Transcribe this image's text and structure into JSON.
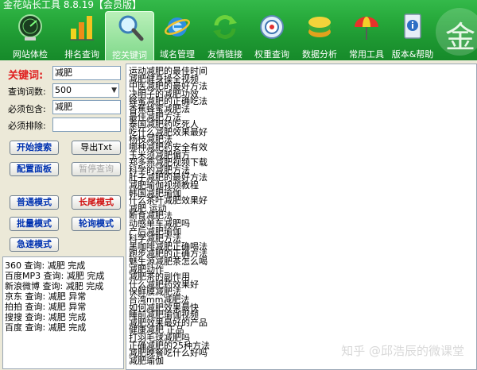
{
  "title": "金花站长工具 8.8.19【会员版】",
  "brand_char": "金",
  "toolbar": [
    {
      "label": "网站体检",
      "icon": "chart-globe-icon"
    },
    {
      "label": "排名查询",
      "icon": "bar-chart-icon"
    },
    {
      "label": "挖关键词",
      "icon": "magnifier-icon"
    },
    {
      "label": "域名管理",
      "icon": "ie-icon"
    },
    {
      "label": "友情链接",
      "icon": "refresh-icon"
    },
    {
      "label": "权重查询",
      "icon": "target-icon"
    },
    {
      "label": "数据分析",
      "icon": "data-stack-icon"
    },
    {
      "label": "常用工具",
      "icon": "umbrella-icon"
    },
    {
      "label": "版本&帮助",
      "icon": "info-icon"
    }
  ],
  "form": {
    "keyword_label": "关键词:",
    "keyword_value": "减肥",
    "query_count_label": "查询词数:",
    "query_count_value": "500",
    "must_include_label": "必须包含:",
    "must_include_value": "减肥",
    "must_exclude_label": "必须排除:",
    "must_exclude_value": ""
  },
  "buttons": {
    "start_search": "开始搜索",
    "export_txt": "导出Txt",
    "config_panel": "配置面板",
    "pause_query": "暂停查询",
    "normal_mode": "普通模式",
    "longtail_mode": "长尾模式",
    "batch_mode": "批量模式",
    "rotation_mode": "轮询模式",
    "fast_mode": "急速模式"
  },
  "log": [
    "360 查询: 减肥 完成",
    "百度MP3 查询: 减肥 完成",
    "新浪微博 查询: 减肥 完成",
    "京东 查询: 减肥 异常",
    "拍拍 查询: 减肥 异常",
    "搜搜 查询: 减肥 完成",
    "百度 查询: 减肥 完成"
  ],
  "results": [
    "运动减肥的最佳时间",
    "减肥健身操全视频",
    "中医减肥的最好方法",
    "决明子的减肥功效",
    "蜂蜜减肥的正确吃法",
    "香蕉蜂蜜减肥法",
    "最佳减肥方法",
    "泰国减肥药吃死人",
    "吃什么减肥效果最好",
    "杨枝减肥法",
    "哪种减肥药安全有效",
    "玉米须减肥偏方",
    "郑多燕减肥视频下载",
    "科学的减肥方法",
    "肚子减肥的最好方法",
    "减肥瑜伽视频教程",
    "韩国减肥瑜伽",
    "什么茶叶减肥效果好",
    "减肥 运动",
    "断食减肥法",
    "动感单车减肥吗",
    "产后减肥瑜伽",
    "科学减肥方法",
    "黑咖啡减肥正确喝法",
    "跑步减肥的正确方法",
    "魅生源减肥茶怎么喝",
    "减肥动作",
    "减肥茶的副作用",
    "什么减肥药效果好",
    "保鲜膜减肥法",
    "台湾mm减肥法",
    "如何减肥效果最快",
    "睡前减肥瑜伽视频",
    "减肥效果最好的产品",
    "健康减肥 正品",
    "打羽毛球减肥吗",
    "正确减肥的25种方法",
    "减肥晚餐吃什么好吗",
    "减肥瑜伽"
  ],
  "watermark": "知乎 @邱浩辰的微课堂"
}
